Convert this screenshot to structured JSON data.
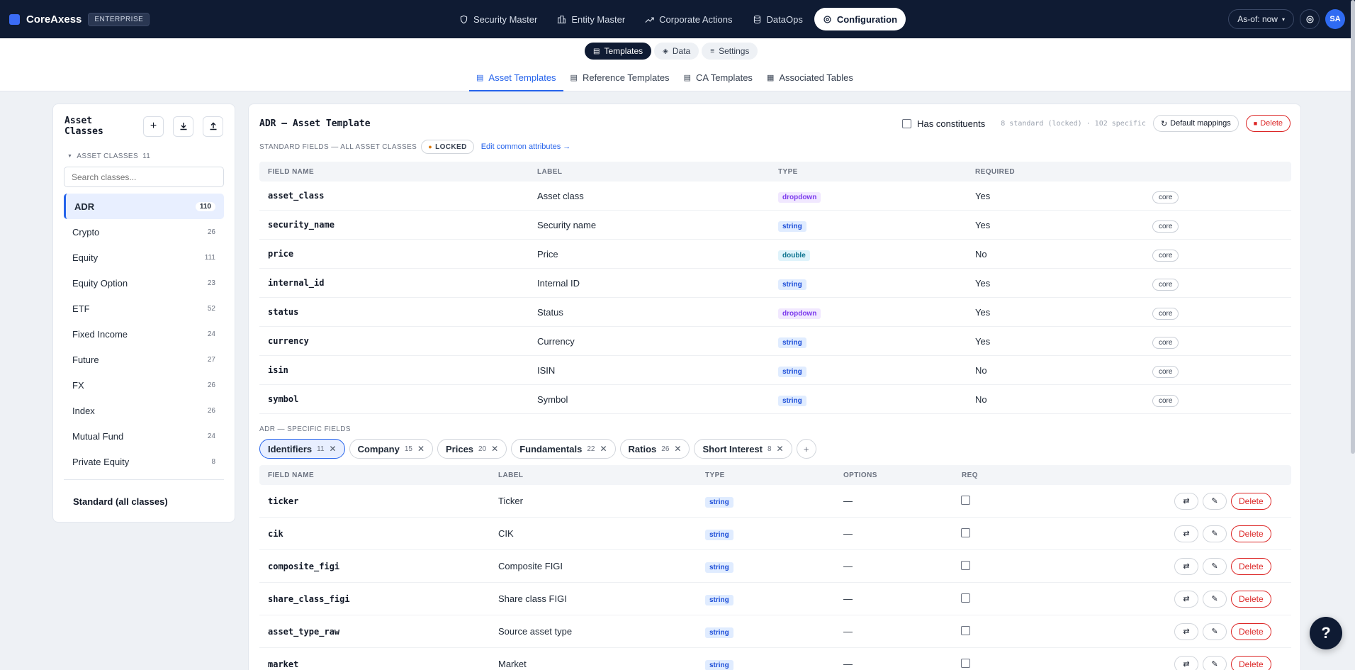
{
  "brand": {
    "name": "CoreAxess",
    "badge": "ENTERPRISE"
  },
  "main_nav": [
    {
      "label": "Security Master",
      "icon": "shield-icon",
      "active": false
    },
    {
      "label": "Entity Master",
      "icon": "building-icon",
      "active": false
    },
    {
      "label": "Corporate Actions",
      "icon": "trend-icon",
      "active": false
    },
    {
      "label": "DataOps",
      "icon": "database-icon",
      "active": false
    },
    {
      "label": "Configuration",
      "icon": "gear-icon",
      "active": true
    }
  ],
  "top_right": {
    "asof": "As-of: now",
    "avatar": "SA"
  },
  "segments": [
    {
      "label": "Templates",
      "active": true
    },
    {
      "label": "Data",
      "active": false
    },
    {
      "label": "Settings",
      "active": false
    }
  ],
  "tabs": [
    {
      "label": "Asset Templates",
      "active": true
    },
    {
      "label": "Reference Templates",
      "active": false
    },
    {
      "label": "CA Templates",
      "active": false
    },
    {
      "label": "Associated Tables",
      "active": false
    }
  ],
  "sidebar": {
    "title": "Asset Classes",
    "section_label": "ASSET CLASSES",
    "section_count": "11",
    "search_placeholder": "Search classes...",
    "classes": [
      {
        "name": "ADR",
        "count": "110",
        "active": true
      },
      {
        "name": "Crypto",
        "count": "26"
      },
      {
        "name": "Equity",
        "count": "111"
      },
      {
        "name": "Equity Option",
        "count": "23"
      },
      {
        "name": "ETF",
        "count": "52"
      },
      {
        "name": "Fixed Income",
        "count": "24"
      },
      {
        "name": "Future",
        "count": "27"
      },
      {
        "name": "FX",
        "count": "26"
      },
      {
        "name": "Index",
        "count": "26"
      },
      {
        "name": "Mutual Fund",
        "count": "24"
      },
      {
        "name": "Private Equity",
        "count": "8"
      }
    ],
    "standard_label": "Standard (all classes)"
  },
  "main": {
    "title": "ADR — Asset Template",
    "has_constituents_label": "Has constituents",
    "counts": "8 standard (locked) · 102 specific",
    "default_mappings": "Default mappings",
    "delete": "Delete",
    "std_section_label": "STANDARD FIELDS — ALL ASSET CLASSES",
    "locked_label": "LOCKED",
    "edit_common": "Edit common attributes →",
    "std_columns": [
      "FIELD NAME",
      "LABEL",
      "TYPE",
      "REQUIRED"
    ],
    "std_fields": [
      {
        "name": "asset_class",
        "label": "Asset class",
        "type": "dropdown",
        "required": "Yes",
        "tag": "core"
      },
      {
        "name": "security_name",
        "label": "Security name",
        "type": "string",
        "required": "Yes",
        "tag": "core"
      },
      {
        "name": "price",
        "label": "Price",
        "type": "double",
        "required": "No",
        "tag": "core"
      },
      {
        "name": "internal_id",
        "label": "Internal ID",
        "type": "string",
        "required": "Yes",
        "tag": "core"
      },
      {
        "name": "status",
        "label": "Status",
        "type": "dropdown",
        "required": "Yes",
        "tag": "core"
      },
      {
        "name": "currency",
        "label": "Currency",
        "type": "string",
        "required": "Yes",
        "tag": "core"
      },
      {
        "name": "isin",
        "label": "ISIN",
        "type": "string",
        "required": "No",
        "tag": "core"
      },
      {
        "name": "symbol",
        "label": "Symbol",
        "type": "string",
        "required": "No",
        "tag": "core"
      }
    ],
    "spec_section_label": "ADR — SPECIFIC FIELDS",
    "groups": [
      {
        "name": "Identifiers",
        "count": "11",
        "active": true
      },
      {
        "name": "Company",
        "count": "15"
      },
      {
        "name": "Prices",
        "count": "20"
      },
      {
        "name": "Fundamentals",
        "count": "22"
      },
      {
        "name": "Ratios",
        "count": "26"
      },
      {
        "name": "Short Interest",
        "count": "8"
      }
    ],
    "spec_columns": [
      "FIELD NAME",
      "LABEL",
      "TYPE",
      "OPTIONS",
      "REQ"
    ],
    "spec_fields": [
      {
        "name": "ticker",
        "label": "Ticker",
        "type": "string",
        "options": "—"
      },
      {
        "name": "cik",
        "label": "CIK",
        "type": "string",
        "options": "—"
      },
      {
        "name": "composite_figi",
        "label": "Composite FIGI",
        "type": "string",
        "options": "—"
      },
      {
        "name": "share_class_figi",
        "label": "Share class FIGI",
        "type": "string",
        "options": "—"
      },
      {
        "name": "asset_type_raw",
        "label": "Source asset type",
        "type": "string",
        "options": "—"
      },
      {
        "name": "market",
        "label": "Market",
        "type": "string",
        "options": "—"
      }
    ],
    "row_delete": "Delete"
  },
  "help_label": "?"
}
